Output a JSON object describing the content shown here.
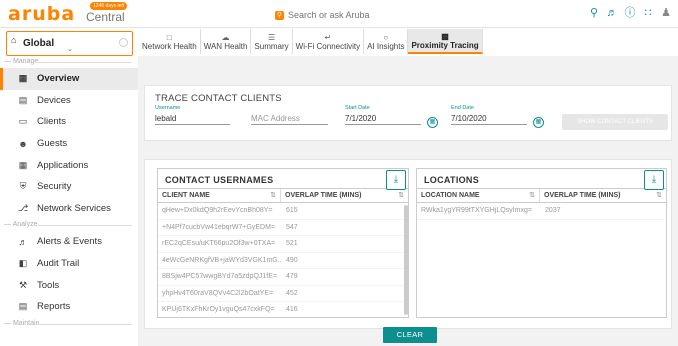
{
  "header": {
    "logo": "aruba",
    "logo_sub": "Central",
    "trial_badge": "1246 days left",
    "search_placeholder": "Search or ask Aruba"
  },
  "global": {
    "label": "Global"
  },
  "tabs": [
    {
      "label": "Network Health",
      "icon": "monitor-icon"
    },
    {
      "label": "WAN Health",
      "icon": "cloud-icon"
    },
    {
      "label": "Summary",
      "icon": "list-icon"
    },
    {
      "label": "Wi-Fi Connectivity",
      "icon": "wifi-icon"
    },
    {
      "label": "AI Insights",
      "icon": "bulb-icon"
    },
    {
      "label": "Proximity Tracing",
      "icon": "phone-icon",
      "active": true
    }
  ],
  "sidebar": {
    "section_manage": "Manage",
    "section_analyze": "Analyze",
    "section_maintain": "Maintain",
    "items": [
      {
        "label": "Overview"
      },
      {
        "label": "Devices"
      },
      {
        "label": "Clients"
      },
      {
        "label": "Guests"
      },
      {
        "label": "Applications"
      },
      {
        "label": "Security"
      },
      {
        "label": "Network Services"
      },
      {
        "label": "Alerts & Events"
      },
      {
        "label": "Audit Trail"
      },
      {
        "label": "Tools"
      },
      {
        "label": "Reports"
      }
    ]
  },
  "trace": {
    "title": "TRACE CONTACT CLIENTS",
    "username_label": "Username",
    "username_value": "lebald",
    "mac_placeholder": "MAC Address",
    "start_label": "Start Date",
    "start_value": "7/1/2020",
    "end_label": "End Date",
    "end_value": "7/10/2020",
    "show_button": "SHOW CONTACT CLIENTS"
  },
  "usernames": {
    "title": "CONTACT USERNAMES",
    "col_client": "CLIENT NAME",
    "col_overlap": "OVERLAP TIME (MINS)",
    "rows": [
      {
        "client": "qHew+Dx0kdQ9h2rEevYcnBh08Y=",
        "overlap": "615"
      },
      {
        "client": "+N4Pf7cucbVw41ebqrW7+GyEDM=",
        "overlap": "547"
      },
      {
        "client": "rEC2qCEsu/uKT66pu2Of3w+0TXA=",
        "overlap": "521"
      },
      {
        "client": "4eWcGeNRKgfVB+jaWYd3VGK1mG...",
        "overlap": "490"
      },
      {
        "client": "8BSjw4PC57wwgBYd7a5zdpQJ1fE=",
        "overlap": "479"
      },
      {
        "client": "yhpHv4T60raV8QVv4C2l2bOatYE=",
        "overlap": "452"
      },
      {
        "client": "KPUj6TKxFhKrOy1vguQs47cxkFQ=",
        "overlap": "416"
      }
    ]
  },
  "locations": {
    "title": "LOCATIONS",
    "col_location": "LOCATION NAME",
    "col_overlap": "OVERLAP TIME (MINS)",
    "rows": [
      {
        "location": "RWka1ygYR99tTXYGHjLQsyImxg=",
        "overlap": "2037"
      }
    ]
  },
  "clear_button": "CLEAR"
}
